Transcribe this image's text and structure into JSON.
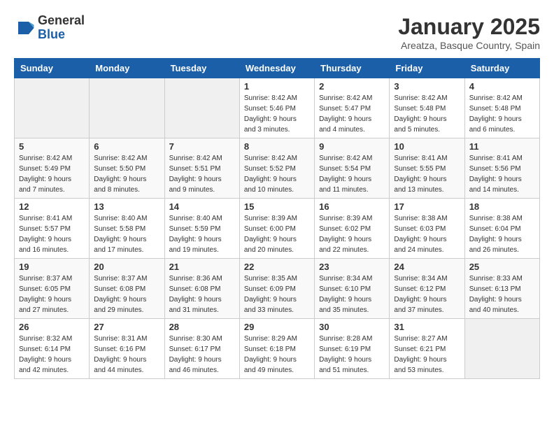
{
  "header": {
    "logo_general": "General",
    "logo_blue": "Blue",
    "month_title": "January 2025",
    "location": "Areatza, Basque Country, Spain"
  },
  "weekdays": [
    "Sunday",
    "Monday",
    "Tuesday",
    "Wednesday",
    "Thursday",
    "Friday",
    "Saturday"
  ],
  "weeks": [
    [
      {
        "day": "",
        "sunrise": "",
        "sunset": "",
        "daylight": ""
      },
      {
        "day": "",
        "sunrise": "",
        "sunset": "",
        "daylight": ""
      },
      {
        "day": "",
        "sunrise": "",
        "sunset": "",
        "daylight": ""
      },
      {
        "day": "1",
        "sunrise": "Sunrise: 8:42 AM",
        "sunset": "Sunset: 5:46 PM",
        "daylight": "Daylight: 9 hours and 3 minutes."
      },
      {
        "day": "2",
        "sunrise": "Sunrise: 8:42 AM",
        "sunset": "Sunset: 5:47 PM",
        "daylight": "Daylight: 9 hours and 4 minutes."
      },
      {
        "day": "3",
        "sunrise": "Sunrise: 8:42 AM",
        "sunset": "Sunset: 5:48 PM",
        "daylight": "Daylight: 9 hours and 5 minutes."
      },
      {
        "day": "4",
        "sunrise": "Sunrise: 8:42 AM",
        "sunset": "Sunset: 5:48 PM",
        "daylight": "Daylight: 9 hours and 6 minutes."
      }
    ],
    [
      {
        "day": "5",
        "sunrise": "Sunrise: 8:42 AM",
        "sunset": "Sunset: 5:49 PM",
        "daylight": "Daylight: 9 hours and 7 minutes."
      },
      {
        "day": "6",
        "sunrise": "Sunrise: 8:42 AM",
        "sunset": "Sunset: 5:50 PM",
        "daylight": "Daylight: 9 hours and 8 minutes."
      },
      {
        "day": "7",
        "sunrise": "Sunrise: 8:42 AM",
        "sunset": "Sunset: 5:51 PM",
        "daylight": "Daylight: 9 hours and 9 minutes."
      },
      {
        "day": "8",
        "sunrise": "Sunrise: 8:42 AM",
        "sunset": "Sunset: 5:52 PM",
        "daylight": "Daylight: 9 hours and 10 minutes."
      },
      {
        "day": "9",
        "sunrise": "Sunrise: 8:42 AM",
        "sunset": "Sunset: 5:54 PM",
        "daylight": "Daylight: 9 hours and 11 minutes."
      },
      {
        "day": "10",
        "sunrise": "Sunrise: 8:41 AM",
        "sunset": "Sunset: 5:55 PM",
        "daylight": "Daylight: 9 hours and 13 minutes."
      },
      {
        "day": "11",
        "sunrise": "Sunrise: 8:41 AM",
        "sunset": "Sunset: 5:56 PM",
        "daylight": "Daylight: 9 hours and 14 minutes."
      }
    ],
    [
      {
        "day": "12",
        "sunrise": "Sunrise: 8:41 AM",
        "sunset": "Sunset: 5:57 PM",
        "daylight": "Daylight: 9 hours and 16 minutes."
      },
      {
        "day": "13",
        "sunrise": "Sunrise: 8:40 AM",
        "sunset": "Sunset: 5:58 PM",
        "daylight": "Daylight: 9 hours and 17 minutes."
      },
      {
        "day": "14",
        "sunrise": "Sunrise: 8:40 AM",
        "sunset": "Sunset: 5:59 PM",
        "daylight": "Daylight: 9 hours and 19 minutes."
      },
      {
        "day": "15",
        "sunrise": "Sunrise: 8:39 AM",
        "sunset": "Sunset: 6:00 PM",
        "daylight": "Daylight: 9 hours and 20 minutes."
      },
      {
        "day": "16",
        "sunrise": "Sunrise: 8:39 AM",
        "sunset": "Sunset: 6:02 PM",
        "daylight": "Daylight: 9 hours and 22 minutes."
      },
      {
        "day": "17",
        "sunrise": "Sunrise: 8:38 AM",
        "sunset": "Sunset: 6:03 PM",
        "daylight": "Daylight: 9 hours and 24 minutes."
      },
      {
        "day": "18",
        "sunrise": "Sunrise: 8:38 AM",
        "sunset": "Sunset: 6:04 PM",
        "daylight": "Daylight: 9 hours and 26 minutes."
      }
    ],
    [
      {
        "day": "19",
        "sunrise": "Sunrise: 8:37 AM",
        "sunset": "Sunset: 6:05 PM",
        "daylight": "Daylight: 9 hours and 27 minutes."
      },
      {
        "day": "20",
        "sunrise": "Sunrise: 8:37 AM",
        "sunset": "Sunset: 6:08 PM",
        "daylight": "Daylight: 9 hours and 29 minutes."
      },
      {
        "day": "21",
        "sunrise": "Sunrise: 8:36 AM",
        "sunset": "Sunset: 6:08 PM",
        "daylight": "Daylight: 9 hours and 31 minutes."
      },
      {
        "day": "22",
        "sunrise": "Sunrise: 8:35 AM",
        "sunset": "Sunset: 6:09 PM",
        "daylight": "Daylight: 9 hours and 33 minutes."
      },
      {
        "day": "23",
        "sunrise": "Sunrise: 8:34 AM",
        "sunset": "Sunset: 6:10 PM",
        "daylight": "Daylight: 9 hours and 35 minutes."
      },
      {
        "day": "24",
        "sunrise": "Sunrise: 8:34 AM",
        "sunset": "Sunset: 6:12 PM",
        "daylight": "Daylight: 9 hours and 37 minutes."
      },
      {
        "day": "25",
        "sunrise": "Sunrise: 8:33 AM",
        "sunset": "Sunset: 6:13 PM",
        "daylight": "Daylight: 9 hours and 40 minutes."
      }
    ],
    [
      {
        "day": "26",
        "sunrise": "Sunrise: 8:32 AM",
        "sunset": "Sunset: 6:14 PM",
        "daylight": "Daylight: 9 hours and 42 minutes."
      },
      {
        "day": "27",
        "sunrise": "Sunrise: 8:31 AM",
        "sunset": "Sunset: 6:16 PM",
        "daylight": "Daylight: 9 hours and 44 minutes."
      },
      {
        "day": "28",
        "sunrise": "Sunrise: 8:30 AM",
        "sunset": "Sunset: 6:17 PM",
        "daylight": "Daylight: 9 hours and 46 minutes."
      },
      {
        "day": "29",
        "sunrise": "Sunrise: 8:29 AM",
        "sunset": "Sunset: 6:18 PM",
        "daylight": "Daylight: 9 hours and 49 minutes."
      },
      {
        "day": "30",
        "sunrise": "Sunrise: 8:28 AM",
        "sunset": "Sunset: 6:19 PM",
        "daylight": "Daylight: 9 hours and 51 minutes."
      },
      {
        "day": "31",
        "sunrise": "Sunrise: 8:27 AM",
        "sunset": "Sunset: 6:21 PM",
        "daylight": "Daylight: 9 hours and 53 minutes."
      },
      {
        "day": "",
        "sunrise": "",
        "sunset": "",
        "daylight": ""
      }
    ]
  ]
}
